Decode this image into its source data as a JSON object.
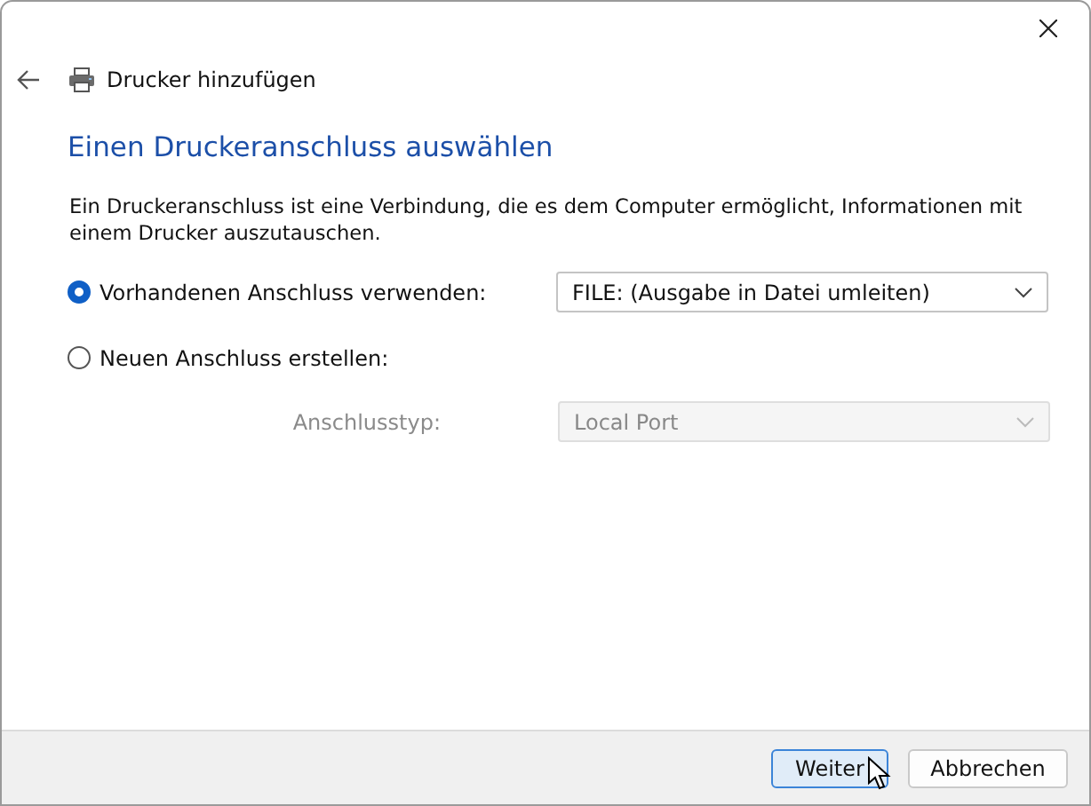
{
  "window": {
    "title": "Drucker hinzufügen"
  },
  "heading": "Einen Druckeranschluss auswählen",
  "description": "Ein Druckeranschluss ist eine Verbindung, die es dem Computer ermöglicht, Informationen mit einem Drucker auszutauschen.",
  "options": [
    {
      "label": "Vorhandenen Anschluss verwenden:",
      "selected": true,
      "dropdown": {
        "value": "FILE: (Ausgabe in Datei umleiten)",
        "disabled": false
      }
    },
    {
      "label": "Neuen Anschluss erstellen:",
      "selected": false,
      "sub_field": {
        "label": "Anschlusstyp:",
        "value": "Local Port",
        "disabled": true
      }
    }
  ],
  "buttons": [
    {
      "label": "Weiter",
      "default": true
    },
    {
      "label": "Abbrechen",
      "default": false
    }
  ]
}
